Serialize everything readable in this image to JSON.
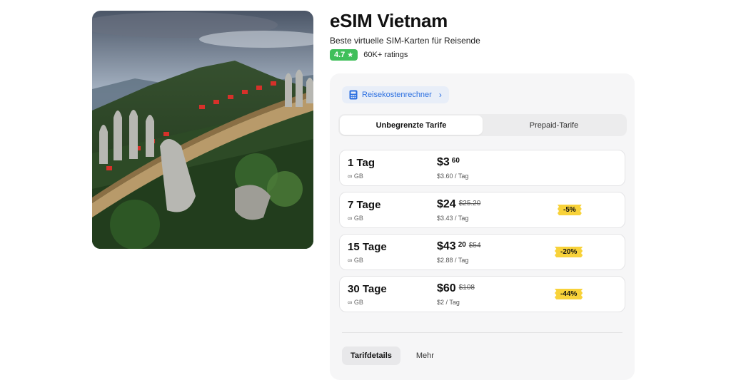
{
  "product": {
    "title": "eSIM Vietnam",
    "subtitle": "Beste virtuelle SIM-Karten für Reisende",
    "rating": "4.7",
    "rating_count": "60K+ ratings"
  },
  "calculator": {
    "label": "Reisekostenrechner",
    "icon": "calculator-icon"
  },
  "plan_tabs": [
    {
      "label": "Unbegrenzte Tarife",
      "active": true
    },
    {
      "label": "Prepaid-Tarife",
      "active": false
    }
  ],
  "plans": [
    {
      "days": "1 Tag",
      "data": "∞ GB",
      "price": "$3",
      "cents": "60",
      "old_price": "",
      "per_day": "$3.60 / Tag",
      "discount": ""
    },
    {
      "days": "7 Tage",
      "data": "∞ GB",
      "price": "$24",
      "cents": "",
      "old_price": "$25.20",
      "per_day": "$3.43 / Tag",
      "discount": "-5%"
    },
    {
      "days": "15 Tage",
      "data": "∞ GB",
      "price": "$43",
      "cents": "20",
      "old_price": "$54",
      "per_day": "$2.88 / Tag",
      "discount": "-20%"
    },
    {
      "days": "30 Tage",
      "data": "∞ GB",
      "price": "$60",
      "cents": "",
      "old_price": "$108",
      "per_day": "$2 / Tag",
      "discount": "-44%"
    }
  ],
  "bottom_tabs": [
    {
      "label": "Tarifdetails",
      "active": true
    },
    {
      "label": "Mehr",
      "active": false
    }
  ],
  "colors": {
    "accent_blue": "#2b6fe0",
    "rating_green": "#3fbf5a",
    "discount_yellow": "#f8d23a"
  }
}
